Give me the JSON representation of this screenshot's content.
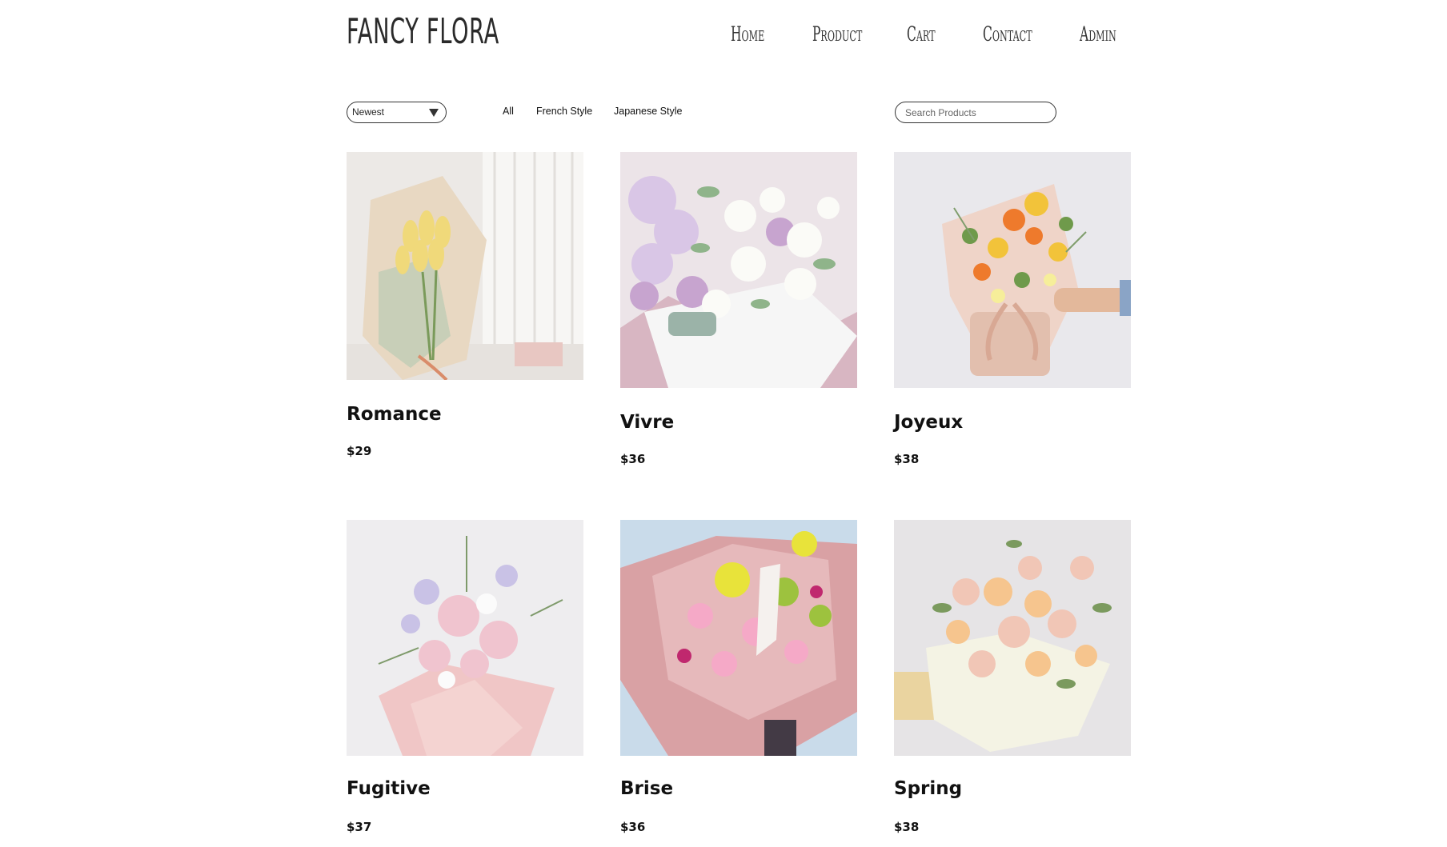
{
  "brand": {
    "logo": "FANCY FLORA"
  },
  "nav": {
    "home": "Home",
    "product": "Product",
    "cart": "Cart",
    "contact": "Contact",
    "admin": "Admin"
  },
  "toolbar": {
    "sort_selected": "Newest",
    "filters": [
      "All",
      "French Style",
      "Japanese Style"
    ],
    "search_placeholder": "Search Products"
  },
  "products": [
    {
      "name": "Romance",
      "price": "$29"
    },
    {
      "name": "Vivre",
      "price": "$36"
    },
    {
      "name": "Joyeux",
      "price": "$38"
    },
    {
      "name": "Fugitive",
      "price": "$37"
    },
    {
      "name": "Brise",
      "price": "$36"
    },
    {
      "name": "Spring",
      "price": "$38"
    }
  ],
  "colors": {
    "text": "#111111",
    "border": "#333333",
    "background": "#ffffff"
  }
}
